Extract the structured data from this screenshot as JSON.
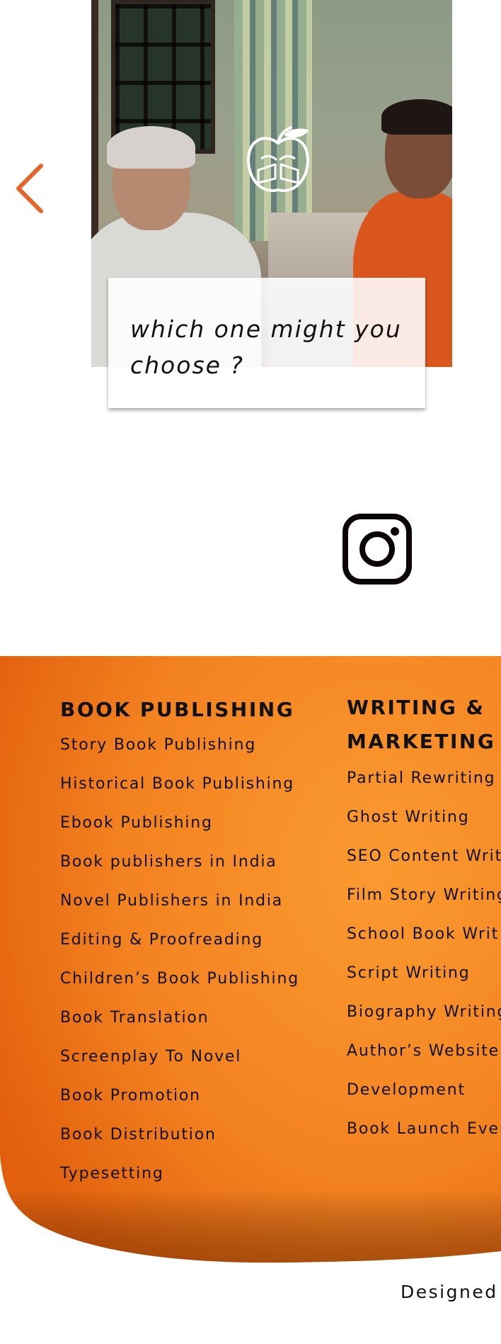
{
  "carousel": {
    "caption": "which one might you choose ?",
    "prev_icon": "chevron-left-icon",
    "accent_color": "#e8632a"
  },
  "social": {
    "instagram_icon": "instagram-icon"
  },
  "footer": {
    "background_colors": [
      "#e8640f",
      "#f7962e"
    ],
    "columns": [
      {
        "title": "BOOK PUBLISHING",
        "links": [
          "Story Book Publishing",
          "Historical Book Publishing",
          "Ebook Publishing",
          "Book publishers in India",
          "Novel Publishers in India",
          "Editing & Proofreading",
          "Children’s Book Publishing",
          "Book Translation",
          "Screenplay To Novel",
          "Book Promotion",
          "Book Distribution",
          "Typesetting"
        ]
      },
      {
        "title": "WRITING & MARKETING",
        "links": [
          "Partial Rewriting",
          "Ghost Writing",
          "SEO Content Writ",
          "Film Story Writing",
          "School Book Writ",
          "Script Writing",
          "Biography Writing",
          "Author’s Website",
          "Development",
          "Book Launch Even"
        ]
      }
    ],
    "designed_text": "Designed"
  }
}
